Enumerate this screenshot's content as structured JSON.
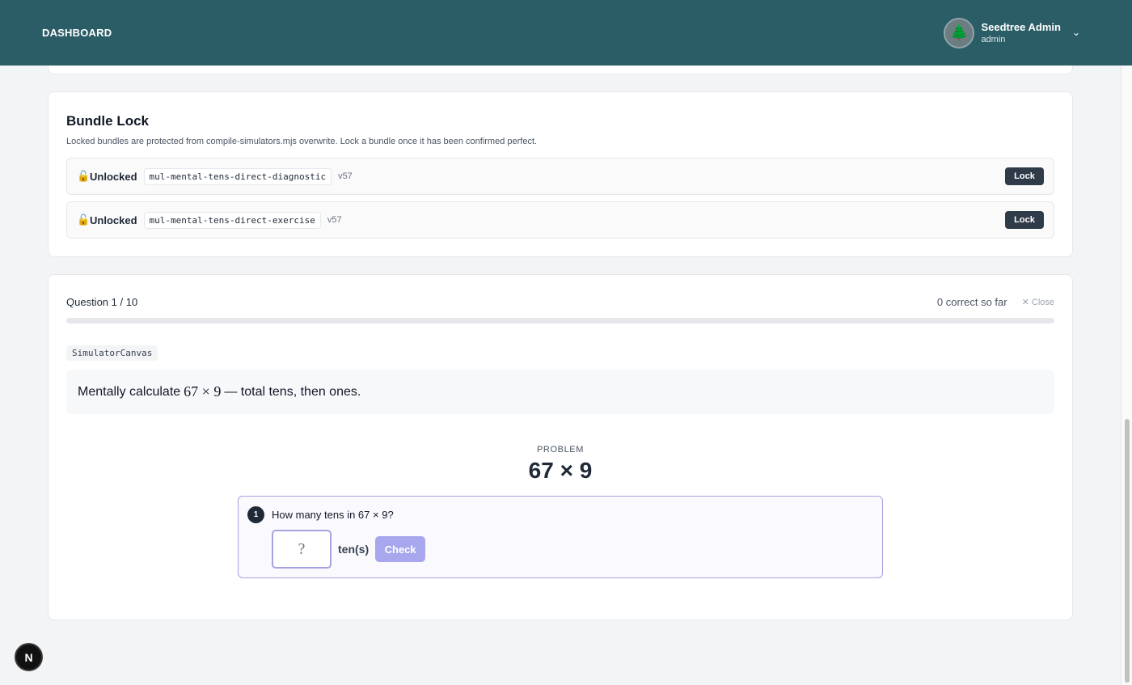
{
  "header": {
    "brand": "DASHBOARD",
    "user_name": "Seedtree Admin",
    "user_role": "admin"
  },
  "bundle_lock": {
    "title": "Bundle Lock",
    "description": "Locked bundles are protected from compile-simulators.mjs overwrite. Lock a bundle once it has been confirmed perfect.",
    "bundles": [
      {
        "status": "Unlocked",
        "id": "mul-mental-tens-direct-diagnostic",
        "version": "v57",
        "action": "Lock"
      },
      {
        "status": "Unlocked",
        "id": "mul-mental-tens-direct-exercise",
        "version": "v57",
        "action": "Lock"
      }
    ]
  },
  "quiz": {
    "question_label": "Question 1 / 10",
    "score_text": "0 correct so far",
    "close_label": "Close",
    "progress_fraction": 0.0,
    "canvas_tag": "SimulatorCanvas",
    "prompt_before": "Mentally calculate",
    "prompt_math": "67 × 9",
    "prompt_after": "— total tens, then ones.",
    "problem_label": "PROBLEM",
    "problem_expr": "67 × 9",
    "step": {
      "number": "1",
      "question": "How many tens in 67 × 9?",
      "input_placeholder": "?",
      "unit": "ten(s)",
      "check_label": "Check"
    }
  },
  "dev_badge": "N",
  "colors": {
    "header_bg": "#2b5d66",
    "accent": "#a8a6ec",
    "lock_button": "#2f3b48"
  }
}
